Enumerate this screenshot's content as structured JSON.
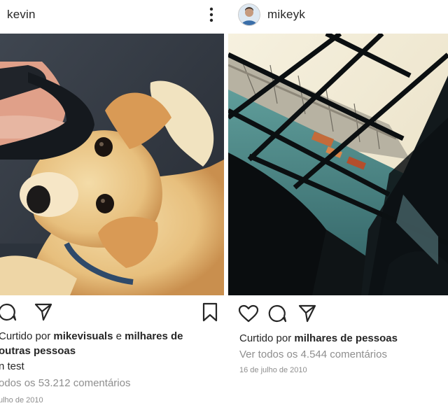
{
  "left_post": {
    "username": "kevin",
    "likes": {
      "prefix": "Curtido por ",
      "user": "mikevisuals",
      "conj": " e ",
      "others": "milhares de",
      "others2": "outras pessoas"
    },
    "caption": "n test",
    "comments": "odos os 53.212 comentários",
    "date": "ulho de 2010"
  },
  "right_post": {
    "username": "mikeyk",
    "likes": {
      "prefix": "Curtido por ",
      "others": "milhares de pessoas"
    },
    "comments": "Ver todos os 4.544 comentários",
    "date": "16 de julho de 2010"
  },
  "icons": {
    "heart": "heart-icon",
    "comment": "comment-icon",
    "share": "paper-plane-icon",
    "save": "bookmark-icon",
    "more": "more-vertical-icon"
  }
}
